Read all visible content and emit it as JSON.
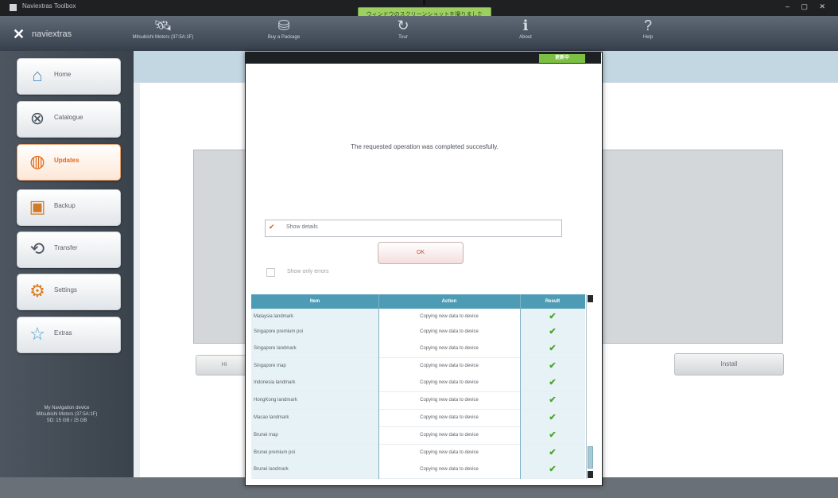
{
  "window": {
    "title": "Naviextras Toolbox",
    "controls": "‒ ▢ ✕",
    "top_notice": "ウィンドウのスクリーンショットを撮りました"
  },
  "topnav": {
    "logo_text": "naviextras",
    "device_label": "Mitsubishi Motors (37:5A:1F)",
    "items": [
      {
        "label": "Buy a Package",
        "icon": "shopping-bag-icon"
      },
      {
        "label": "Tour",
        "icon": "refresh-icon"
      },
      {
        "label": "About",
        "icon": "info-icon"
      },
      {
        "label": "Help",
        "icon": "question-icon"
      }
    ]
  },
  "sidebar": {
    "items": [
      {
        "label": "Home",
        "icon": "home-icon"
      },
      {
        "label": "Catalogue",
        "icon": "catalogue-icon"
      },
      {
        "label": "Updates",
        "icon": "globe-icon",
        "active": true
      },
      {
        "label": "Backup",
        "icon": "backup-icon"
      },
      {
        "label": "Transfer",
        "icon": "transfer-icon"
      },
      {
        "label": "Settings",
        "icon": "settings-icon"
      },
      {
        "label": "Extras",
        "icon": "star-icon"
      }
    ],
    "device_info": [
      "My Navigation device",
      "Mitsubishi Motors (37:5A:1F)",
      "SD: 15 GB / 15 GB"
    ]
  },
  "background": {
    "install_label": "Install",
    "left_button_label": "Hi"
  },
  "dialog": {
    "badge": "更新中",
    "message": "The requested operation was completed succesfully.",
    "show_details_label": "Show details",
    "show_details_checked": true,
    "ok_label": "OK",
    "show_only_errors_label": "Show only errors",
    "show_only_errors_checked": false,
    "table": {
      "columns": [
        "Item",
        "Action",
        "Result"
      ],
      "rows": [
        {
          "item": "Malaysia landmark",
          "action": "Copying new data to device",
          "result": "✔"
        },
        {
          "item": "Singapore premium poi",
          "action": "Copying new data to device",
          "result": "✔"
        },
        {
          "item": "Singapore landmark",
          "action": "Copying new data to device",
          "result": "✔"
        },
        {
          "item": "Singapore map",
          "action": "Copying new data to device",
          "result": "✔"
        },
        {
          "item": "Indonesia landmark",
          "action": "Copying new data to device",
          "result": "✔"
        },
        {
          "item": "HongKong landmark",
          "action": "Copying new data to device",
          "result": "✔"
        },
        {
          "item": "Macao landmark",
          "action": "Copying new data to device",
          "result": "✔"
        },
        {
          "item": "Brunei map",
          "action": "Copying new data to device",
          "result": "✔"
        },
        {
          "item": "Brunei premium poi",
          "action": "Copying new data to device",
          "result": "✔"
        },
        {
          "item": "Brunei landmark",
          "action": "Copying new data to device",
          "result": "✔"
        }
      ]
    }
  },
  "colors": {
    "accent_green": "#7bc043",
    "active_orange": "#e06a1a",
    "table_header": "#4e9bb5"
  }
}
